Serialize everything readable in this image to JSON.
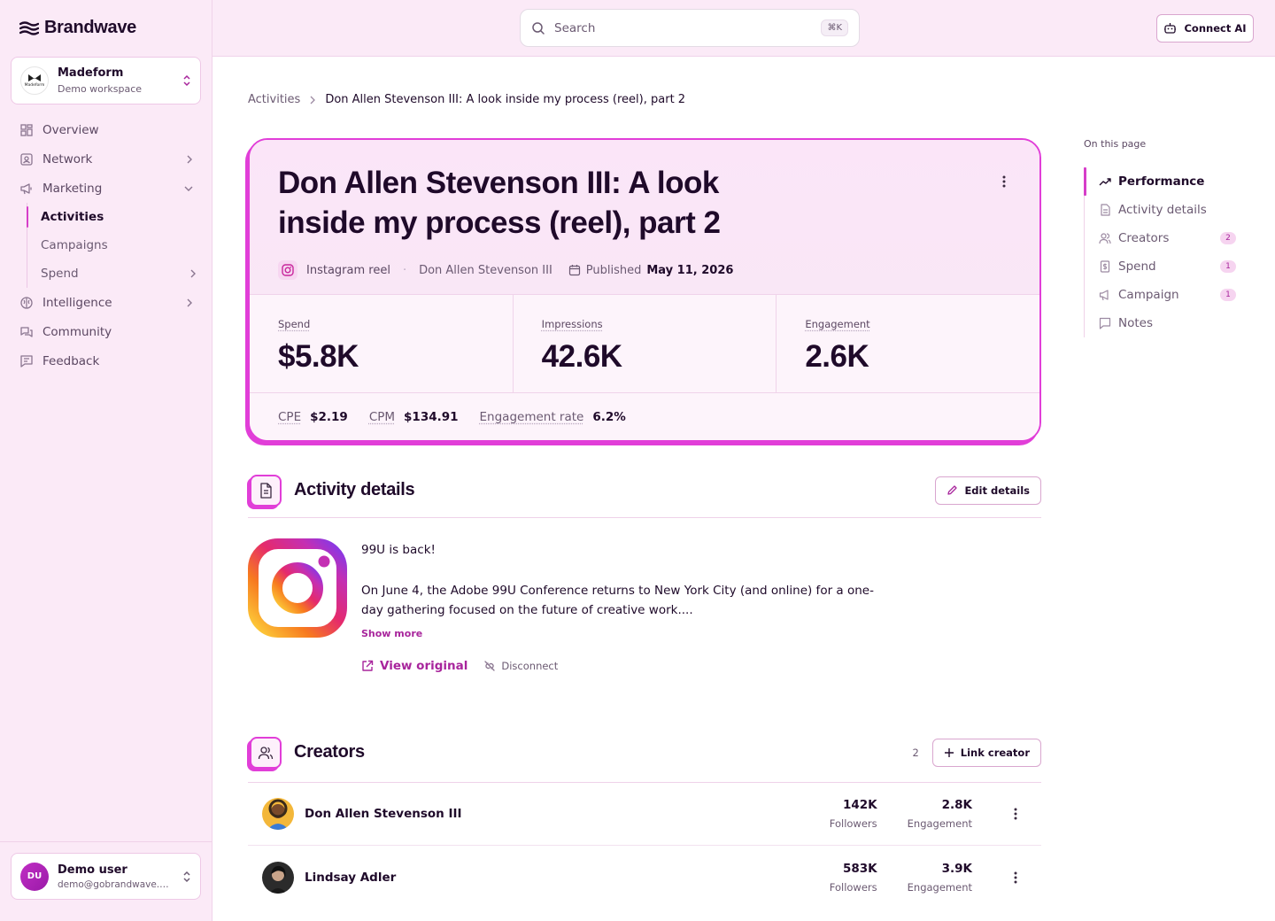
{
  "app": {
    "brand": "Brandwave"
  },
  "workspace": {
    "name": "Madeform",
    "subtitle": "Demo workspace",
    "logo_text": "Madeform"
  },
  "nav": {
    "overview": "Overview",
    "network": "Network",
    "marketing": "Marketing",
    "activities": "Activities",
    "campaigns": "Campaigns",
    "spend": "Spend",
    "intelligence": "Intelligence",
    "community": "Community",
    "feedback": "Feedback"
  },
  "user": {
    "initials": "DU",
    "name": "Demo user",
    "email": "demo@gobrandwave.co..."
  },
  "search": {
    "placeholder": "Search",
    "shortcut": "⌘K"
  },
  "topbar": {
    "connect_label": "Connect AI"
  },
  "breadcrumb": {
    "parent": "Activities",
    "current": "Don Allen Stevenson III: A look inside my process (reel), part 2"
  },
  "hero": {
    "title": "Don Allen Stevenson III: A look inside my process (reel), part 2",
    "type": "Instagram reel",
    "creator": "Don Allen Stevenson III",
    "published_label": "Published",
    "published_date": "May 11, 2026",
    "stats": [
      {
        "label": "Spend",
        "value": "$5.8K"
      },
      {
        "label": "Impressions",
        "value": "42.6K"
      },
      {
        "label": "Engagement",
        "value": "2.6K"
      }
    ],
    "footer": [
      {
        "label": "CPE",
        "value": "$2.19"
      },
      {
        "label": "CPM",
        "value": "$134.91"
      },
      {
        "label": "Engagement rate",
        "value": "6.2%"
      }
    ]
  },
  "activity_details": {
    "title": "Activity details",
    "edit_label": "Edit details",
    "text_line1": "99U is back!",
    "text_line2": "On June 4, the Adobe 99U Conference returns to New York City (and online) for a one-day gathering focused on the future of creative work....",
    "show_more": "Show more",
    "view_original": "View original",
    "disconnect": "Disconnect"
  },
  "creators": {
    "title": "Creators",
    "count": "2",
    "link_label": "Link creator",
    "followers_label": "Followers",
    "engagement_label": "Engagement",
    "rows": [
      {
        "name": "Don Allen Stevenson III",
        "followers": "142K",
        "engagement": "2.8K"
      },
      {
        "name": "Lindsay Adler",
        "followers": "583K",
        "engagement": "3.9K"
      }
    ]
  },
  "toc": {
    "title": "On this page",
    "items": [
      {
        "label": "Performance",
        "badge": ""
      },
      {
        "label": "Activity details",
        "badge": ""
      },
      {
        "label": "Creators",
        "badge": "2"
      },
      {
        "label": "Spend",
        "badge": "1"
      },
      {
        "label": "Campaign",
        "badge": "1"
      },
      {
        "label": "Notes",
        "badge": ""
      }
    ]
  },
  "colors": {
    "accent": "#e13ed8",
    "accent_dark": "#a8259c",
    "sidebar_bg": "#fbeaf7",
    "text": "#1f0a2a"
  },
  "icons": [
    "waves-icon",
    "search-icon",
    "bot-icon",
    "grid-icon",
    "network-icon",
    "megaphone-icon",
    "brain-icon",
    "chat-icon",
    "feedback-icon",
    "instagram-icon",
    "calendar-icon",
    "kebab-icon",
    "document-icon",
    "pencil-icon",
    "external-link-icon",
    "unlink-icon",
    "users-icon",
    "plus-icon",
    "trend-icon",
    "receipt-icon"
  ]
}
